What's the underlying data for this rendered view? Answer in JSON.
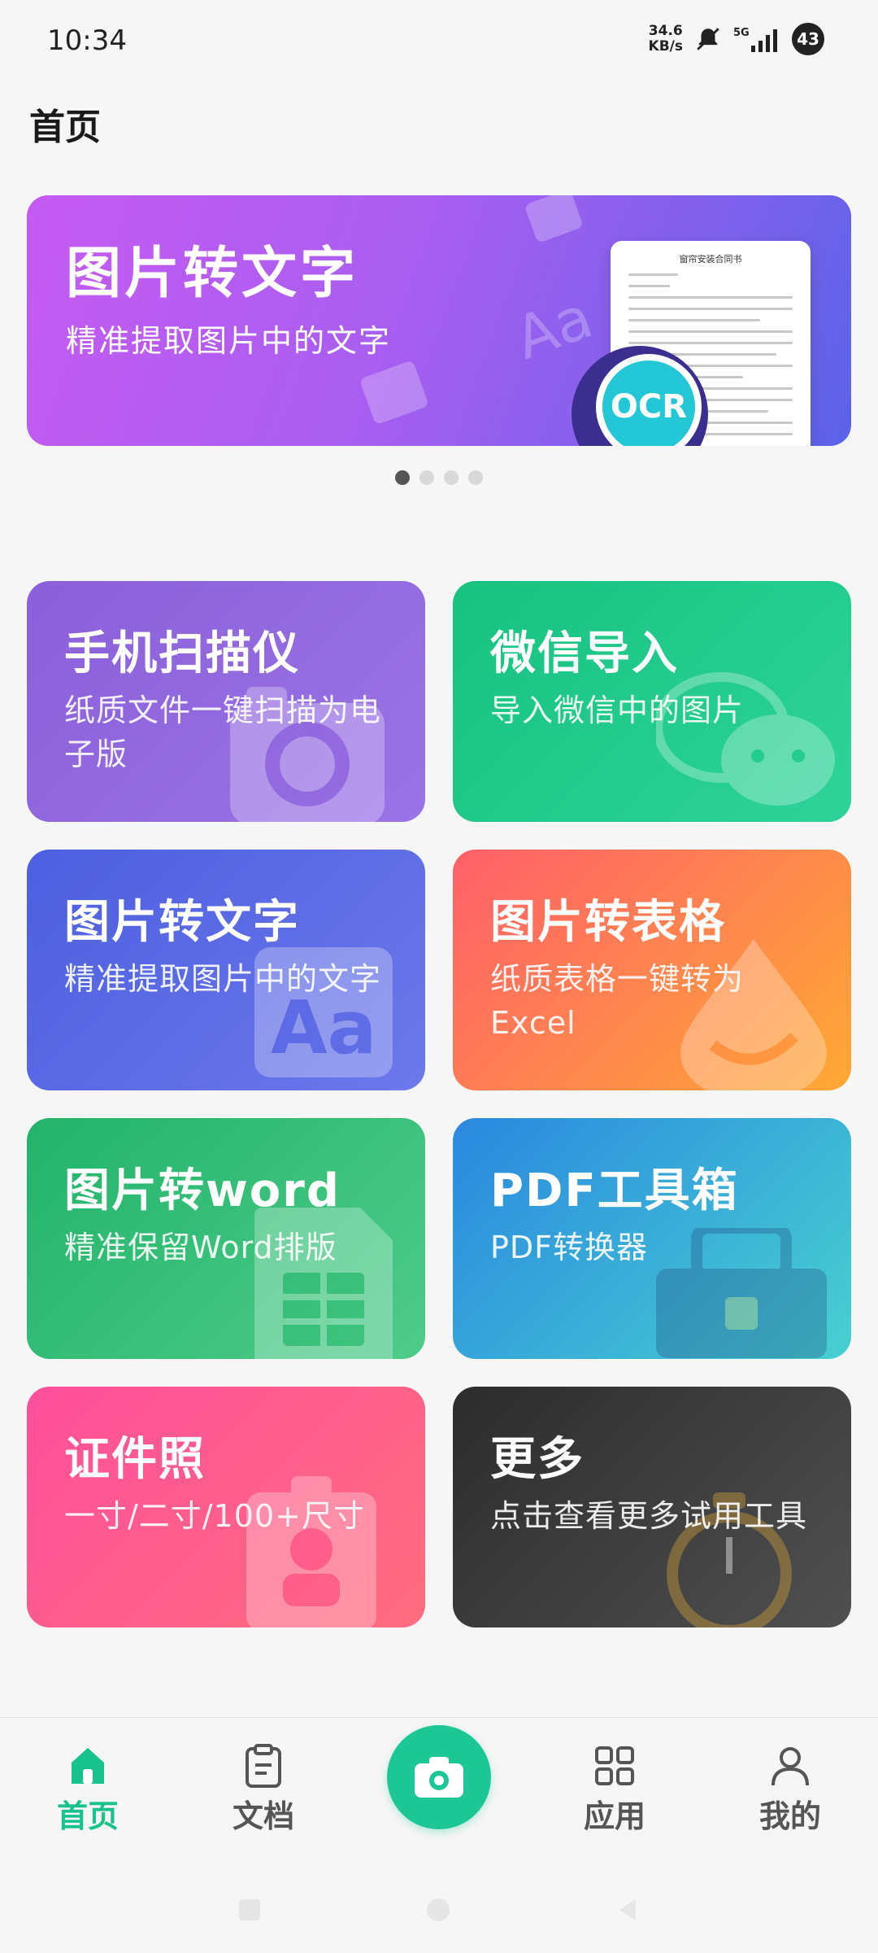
{
  "status_bar": {
    "time": "10:34",
    "net_speed_value": "34.6",
    "net_speed_unit": "KB/s",
    "network": "5G",
    "battery": "43"
  },
  "page_title": "首页",
  "banner": {
    "title": "图片转文字",
    "subtitle": "精准提取图片中的文字",
    "doc_title": "窗帘安装合同书",
    "badge": "OCR",
    "page_count": 4,
    "active_page": 0
  },
  "tools": [
    {
      "title": "手机扫描仪",
      "subtitle": "纸质文件一键扫描为电子版",
      "icon": "camera-icon"
    },
    {
      "title": "微信导入",
      "subtitle": "导入微信中的图片",
      "icon": "wechat-icon"
    },
    {
      "title": "图片转文字",
      "subtitle": "精准提取图片中的文字",
      "icon": "text-aa-icon"
    },
    {
      "title": "图片转表格",
      "subtitle": "纸质表格一键转为Excel",
      "icon": "drop-icon"
    },
    {
      "title": "图片转word",
      "subtitle": "精准保留Word排版",
      "icon": "spreadsheet-icon"
    },
    {
      "title": "PDF工具箱",
      "subtitle": "PDF转换器",
      "icon": "toolbox-icon"
    },
    {
      "title": "证件照",
      "subtitle": "一寸/二寸/100+尺寸",
      "icon": "id-badge-icon"
    },
    {
      "title": "更多",
      "subtitle": "点击查看更多试用工具",
      "icon": "stopwatch-icon"
    }
  ],
  "bottom_nav": {
    "home": "首页",
    "docs": "文档",
    "apps": "应用",
    "mine": "我的",
    "active": "home"
  },
  "colors": {
    "accent": "#18c28c",
    "camera_button": "#1cc795"
  }
}
